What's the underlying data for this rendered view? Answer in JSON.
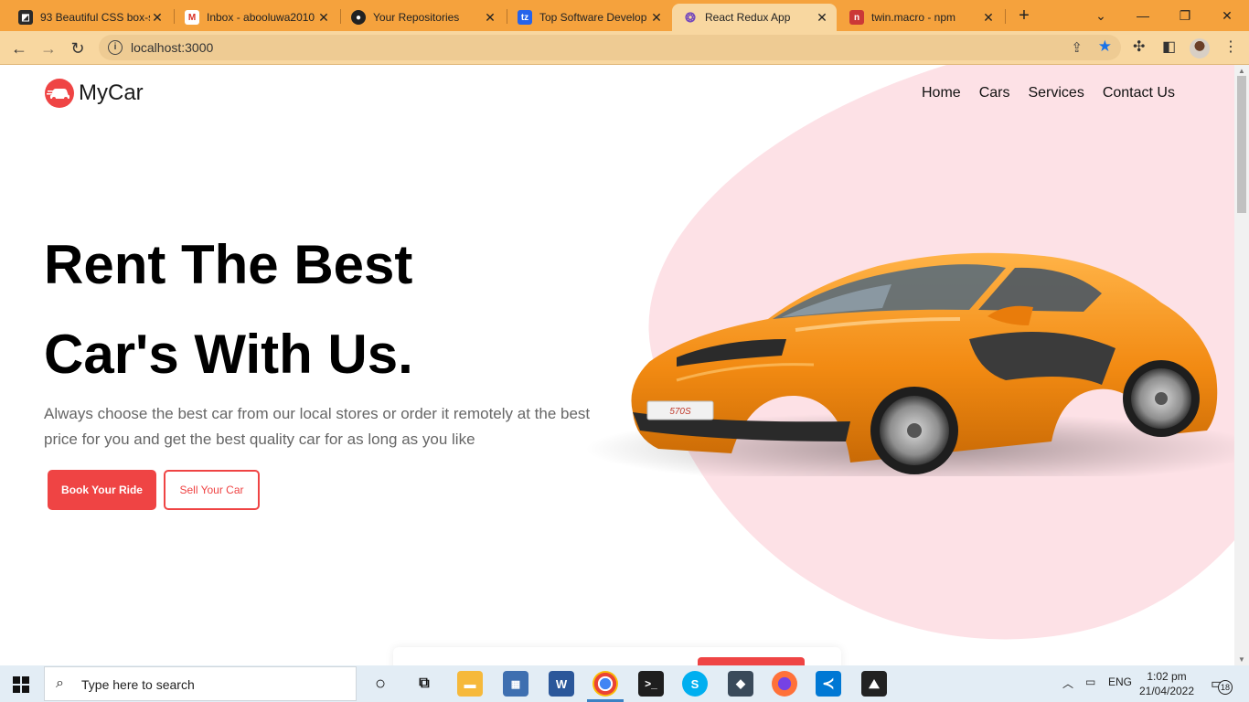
{
  "browser": {
    "tabs": [
      {
        "title": "93 Beautiful CSS box-s",
        "favicon": "codepen-icon",
        "color": "#2a2a2a",
        "active": false
      },
      {
        "title": "Inbox - abooluwa2010",
        "favicon": "gmail-icon",
        "color": "#d93025",
        "active": false
      },
      {
        "title": "Your Repositories",
        "favicon": "github-icon",
        "color": "#222222",
        "active": false
      },
      {
        "title": "Top Software Develop",
        "favicon": "toptal-icon",
        "color": "#2563eb",
        "active": false
      },
      {
        "title": "React Redux App",
        "favicon": "react-redux-icon",
        "color": "#764abc",
        "active": true
      },
      {
        "title": "twin.macro - npm",
        "favicon": "npm-icon",
        "color": "#cb3837",
        "active": false
      }
    ],
    "url": "localhost:3000",
    "star_color": "#1a73e8"
  },
  "page": {
    "logo_text": "MyCar",
    "brand_color": "#ef4444",
    "blob_color": "#fde1e6",
    "nav": [
      "Home",
      "Cars",
      "Services",
      "Contact Us"
    ],
    "headline_line1": "Rent The Best",
    "headline_line2": "Car's With Us.",
    "subtext": "Always choose the best car from our local stores or order it remotely at the best price for you and get the best quality car for as long as you like",
    "book_button": "Book Your Ride",
    "sell_button": "Sell Your Car",
    "car_image": "orange-sports-car"
  },
  "taskbar": {
    "search_placeholder": "Type here to search",
    "apps": [
      "cortana-icon",
      "task-view-icon",
      "file-explorer-icon",
      "app-window-icon",
      "word-icon",
      "chrome-icon",
      "terminal-icon",
      "skype-icon",
      "ssms-icon",
      "firefox-icon",
      "vscode-icon",
      "photos-icon"
    ],
    "language": "ENG",
    "time": "1:02 pm",
    "date": "21/04/2022",
    "notification_count": "18"
  }
}
